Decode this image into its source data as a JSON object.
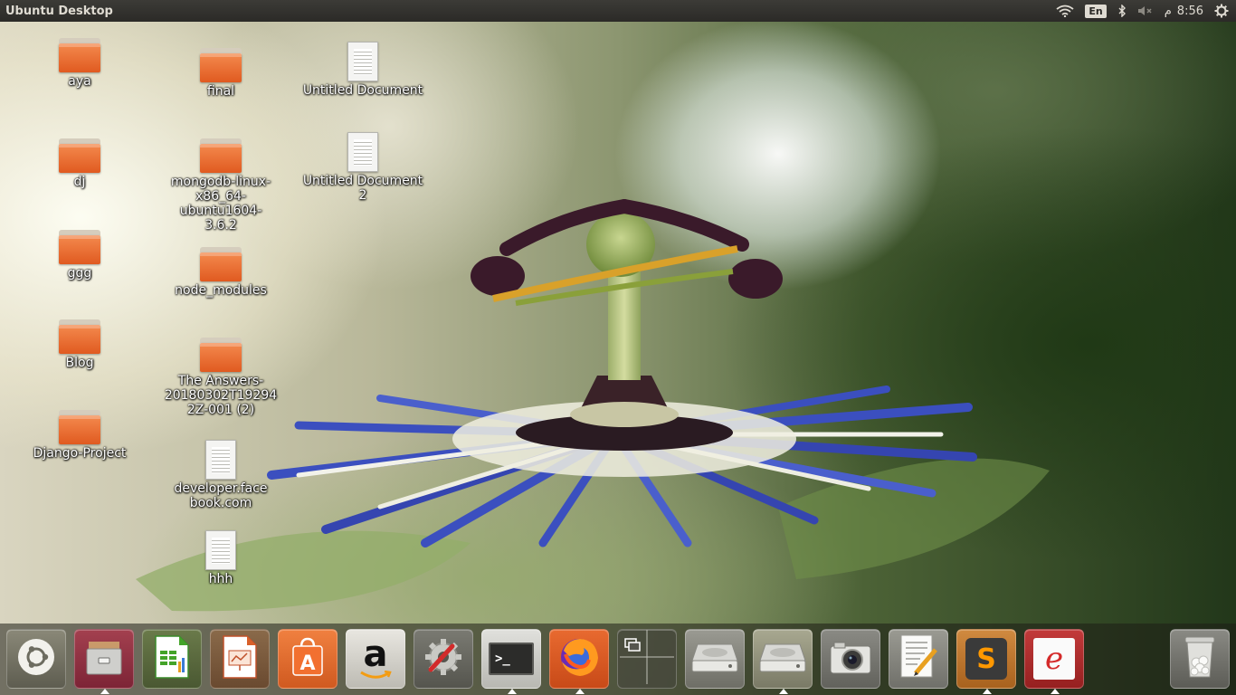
{
  "top_panel": {
    "title": "Ubuntu Desktop",
    "keyboard_layout": "En",
    "clock": "8:56",
    "clock_suffix": "م"
  },
  "desktop_icons": [
    {
      "label": "aya",
      "kind": "folder"
    },
    {
      "label": "dj",
      "kind": "folder"
    },
    {
      "label": "ggg",
      "kind": "folder"
    },
    {
      "label": "Blog",
      "kind": "folder"
    },
    {
      "label": "Django-Project",
      "kind": "folder"
    },
    {
      "label": "final",
      "kind": "folder"
    },
    {
      "label": "mongodb-linux-x86_64-ubuntu1604-3.6.2",
      "kind": "folder"
    },
    {
      "label": "node_modules",
      "kind": "folder"
    },
    {
      "label": "The Answers-20180302T192942Z-001 (2)",
      "kind": "folder"
    },
    {
      "label": "developer.facebook.com",
      "kind": "document"
    },
    {
      "label": "hhh",
      "kind": "document"
    },
    {
      "label": "Untitled Document",
      "kind": "document"
    },
    {
      "label": "Untitled Document 2",
      "kind": "document"
    }
  ],
  "launcher": [
    {
      "name": "Ubuntu Dash",
      "icon": "ubuntu-logo-icon",
      "running": false
    },
    {
      "name": "Files",
      "icon": "file-cabinet-icon",
      "running": true
    },
    {
      "name": "LibreOffice Calc",
      "icon": "spreadsheet-icon",
      "running": false
    },
    {
      "name": "LibreOffice Impress",
      "icon": "presentation-icon",
      "running": false
    },
    {
      "name": "Ubuntu Software",
      "icon": "software-bag-icon",
      "running": false
    },
    {
      "name": "Amazon",
      "icon": "amazon-icon",
      "running": false
    },
    {
      "name": "System Settings",
      "icon": "settings-tools-icon",
      "running": false
    },
    {
      "name": "Terminal",
      "icon": "terminal-icon",
      "running": true
    },
    {
      "name": "Firefox",
      "icon": "firefox-icon",
      "running": true
    },
    {
      "name": "Workspace Switcher",
      "icon": "workspace-switcher-icon",
      "running": false
    },
    {
      "name": "Drive",
      "icon": "hard-drive-icon",
      "running": false
    },
    {
      "name": "Drive 2",
      "icon": "hard-drive-icon",
      "running": true
    },
    {
      "name": "Shotwell",
      "icon": "camera-icon",
      "running": false
    },
    {
      "name": "Text Editor",
      "icon": "text-editor-icon",
      "running": false
    },
    {
      "name": "Sublime Text",
      "icon": "sublime-text-icon",
      "running": true
    },
    {
      "name": "Web App",
      "icon": "red-e-icon",
      "running": true
    },
    {
      "name": "Trash",
      "icon": "trash-icon",
      "running": false
    }
  ],
  "launcher_glyphs": {
    "amazon": "a",
    "terminal": ">_",
    "sublime": "S",
    "red_e": "e"
  }
}
